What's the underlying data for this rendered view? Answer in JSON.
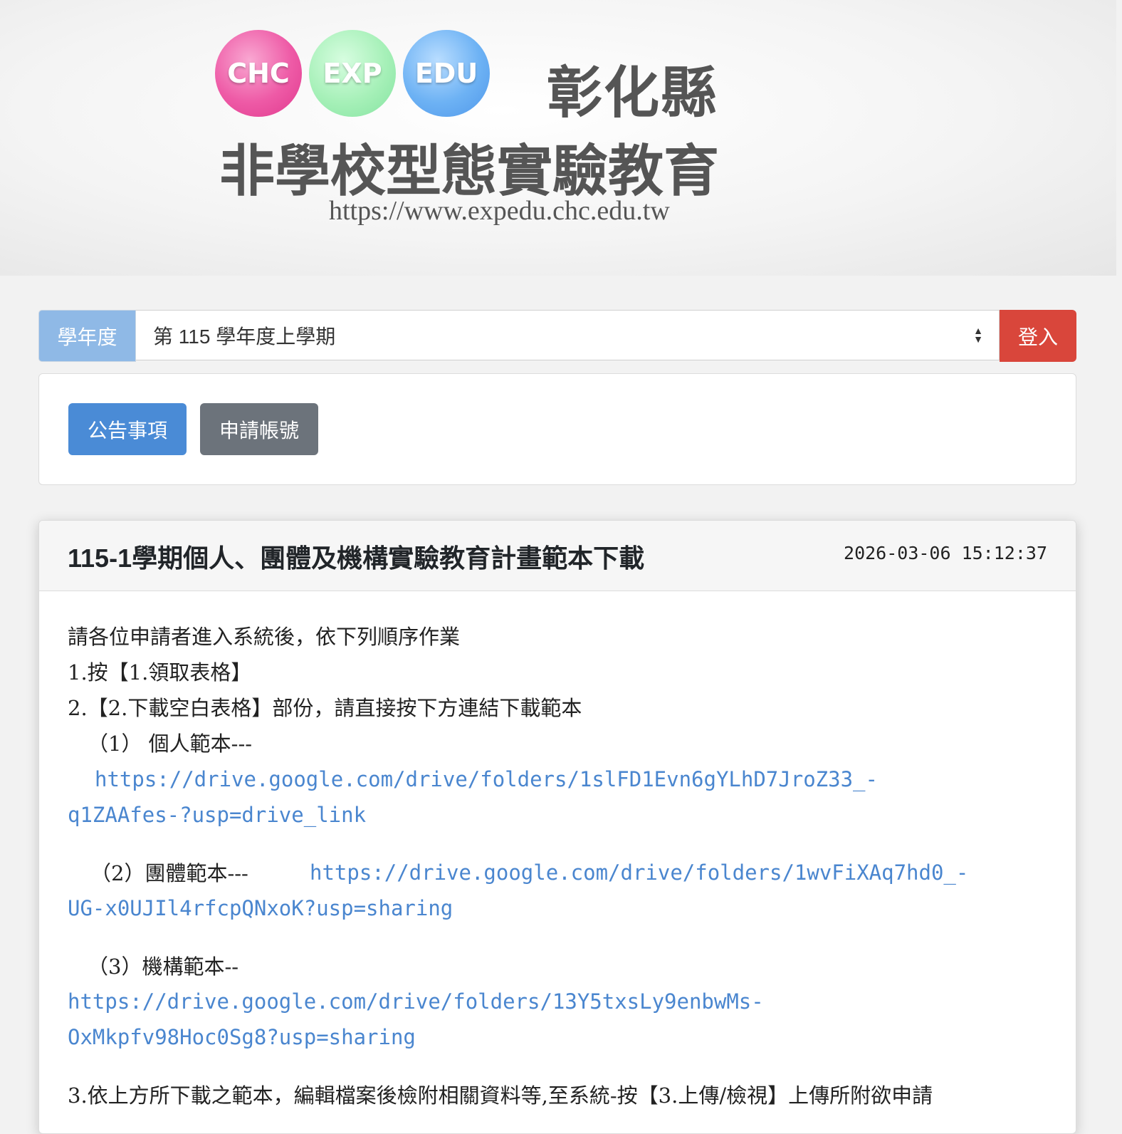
{
  "banner": {
    "circles": [
      "CHC",
      "EXP",
      "EDU"
    ],
    "county": "彰化縣",
    "title": "非學校型態實驗教育",
    "url": "https://www.expedu.chc.edu.tw"
  },
  "year_bar": {
    "label": "學年度",
    "selected": "第 115 學年度上學期",
    "login_label": "登入"
  },
  "tabs": {
    "announcements": "公告事項",
    "apply_account": "申請帳號"
  },
  "article": {
    "title": "115-1學期個人、團體及機構實驗教育計畫範本下載",
    "timestamp": "2026-03-06 15:12:37",
    "intro": "請各位申請者進入系統後，依下列順序作業",
    "step1": "1.按【1.領取表格】",
    "step2": "2.【2.下載空白表格】部份，請直接按下方連結下載範本",
    "item1_label": "（1） 個人範本---",
    "item1_link_a": "https://drive.google.com/drive/folders/1slFD1Evn6gYLhD7JroZ33_-",
    "item1_link_b": "q1ZAAfes-?usp=drive_link",
    "item2_label": "（2）團體範本---",
    "item2_link_a": "https://drive.google.com/drive/folders/1wvFiXAq7hd0_-",
    "item2_link_b": "UG-x0UJIl4rfcpQNxoK?usp=sharing",
    "item3_label": "（3）機構範本--",
    "item3_link_a": "https://drive.google.com/drive/folders/13Y5txsLy9enbwMs-",
    "item3_link_b": "OxMkpfv98Hoc0Sg8?usp=sharing",
    "step3": "3.依上方所下載之範本，編輯檔案後檢附相關資料等,至系統-按【3.上傳/檢視】上傳所附欲申請"
  },
  "colors": {
    "primary": "#4a8bd6",
    "secondary": "#6c737b",
    "danger": "#d9463b",
    "link": "#4a86cf",
    "label_bg": "#8fb9e6"
  }
}
